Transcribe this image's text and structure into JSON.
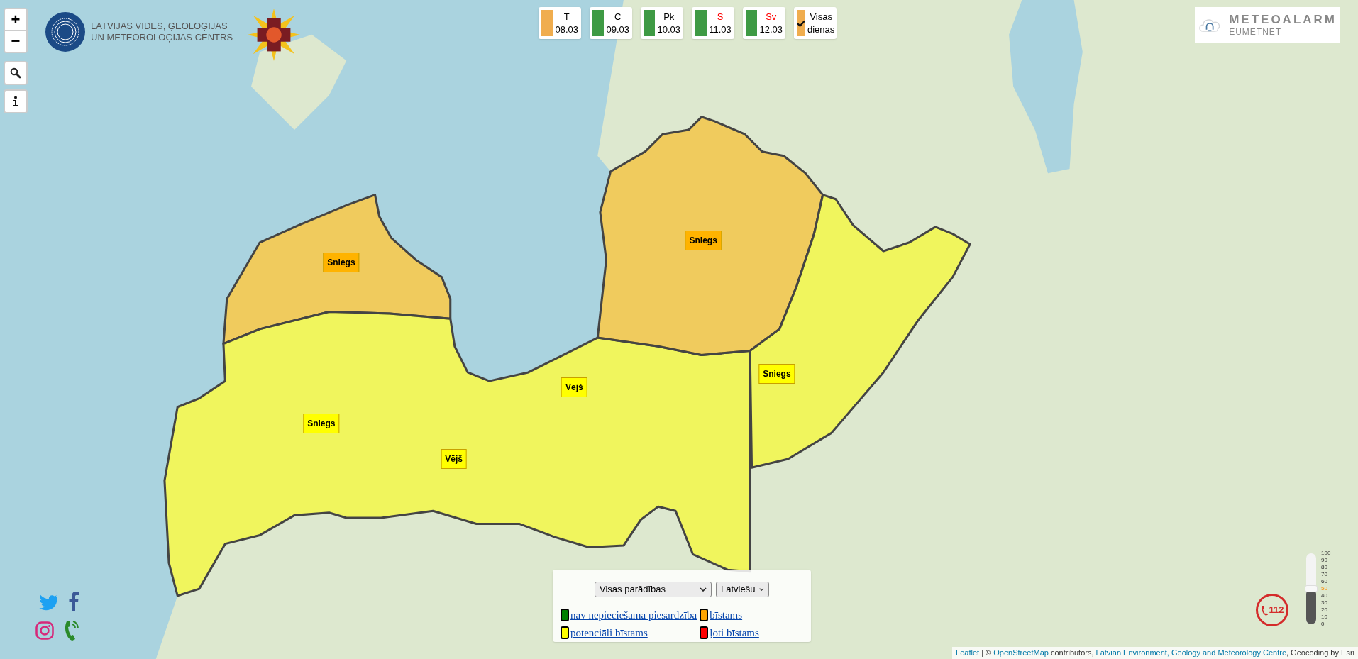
{
  "map_controls": {
    "zoom_in": "+",
    "zoom_out": "−"
  },
  "agency_logo": {
    "line1": "LATVIJAS VIDES, ĢEOLOĢIJAS",
    "line2": "UN METEOROLOĢIJAS CENTRS"
  },
  "days": [
    {
      "label": "T",
      "sublabel": "08.03",
      "color": "#f0ad4e",
      "weekend": false,
      "selected": false
    },
    {
      "label": "C",
      "sublabel": "09.03",
      "color": "#3e9a44",
      "weekend": false,
      "selected": false
    },
    {
      "label": "Pk",
      "sublabel": "10.03",
      "color": "#3e9a44",
      "weekend": false,
      "selected": false
    },
    {
      "label": "S",
      "sublabel": "11.03",
      "color": "#3e9a44",
      "weekend": true,
      "selected": false
    },
    {
      "label": "Sv",
      "sublabel": "12.03",
      "color": "#3e9a44",
      "weekend": true,
      "selected": false
    },
    {
      "label": "Visas",
      "sublabel": "dienas",
      "color": "#f0ad4e",
      "weekend": false,
      "selected": true
    }
  ],
  "meteoalarm_logo": {
    "title": "METEOALARM",
    "subtitle": "EUMETNET"
  },
  "warning_areas": [
    {
      "color": "#ffb300",
      "labels": [
        "Sniegs"
      ]
    },
    {
      "color": "#ffff00",
      "labels": [
        "Vējš",
        "Sniegs",
        "Vējš"
      ]
    },
    {
      "color": "#ffb300",
      "labels": [
        "Sniegs"
      ]
    },
    {
      "color": "#ffff00",
      "labels": [
        "Sniegs"
      ]
    }
  ],
  "legend": {
    "filter": "Visas parādības",
    "language": "Latviešu",
    "items": [
      {
        "label": "nav nepieciešama piesardzība",
        "color": "#008000"
      },
      {
        "label": "bīstams",
        "color": "#ffa500"
      },
      {
        "label": "potenciāli bīstams",
        "color": "#ffff00"
      },
      {
        "label": "ļoti bīstams",
        "color": "#ff0000"
      }
    ]
  },
  "emergency": {
    "number": "112"
  },
  "slider": {
    "level": 0.5,
    "ticks": [
      {
        "label": "100",
        "selected": false
      },
      {
        "label": "90",
        "selected": false
      },
      {
        "label": "80",
        "selected": false
      },
      {
        "label": "70",
        "selected": false
      },
      {
        "label": "60",
        "selected": false
      },
      {
        "label": "50",
        "selected": true
      },
      {
        "label": "40",
        "selected": false
      },
      {
        "label": "30",
        "selected": false
      },
      {
        "label": "20",
        "selected": false
      },
      {
        "label": "10",
        "selected": false
      },
      {
        "label": "0",
        "selected": false
      }
    ]
  },
  "attribution": [
    {
      "text": "Leaflet",
      "link": true
    },
    {
      "text": " | © ",
      "link": false
    },
    {
      "text": "OpenStreetMap",
      "link": true
    },
    {
      "text": " contributors, ",
      "link": false
    },
    {
      "text": "Latvian Environment, Geology and Meteorology Centre",
      "link": true
    },
    {
      "text": ", Geocoding by Esri",
      "link": false
    }
  ]
}
